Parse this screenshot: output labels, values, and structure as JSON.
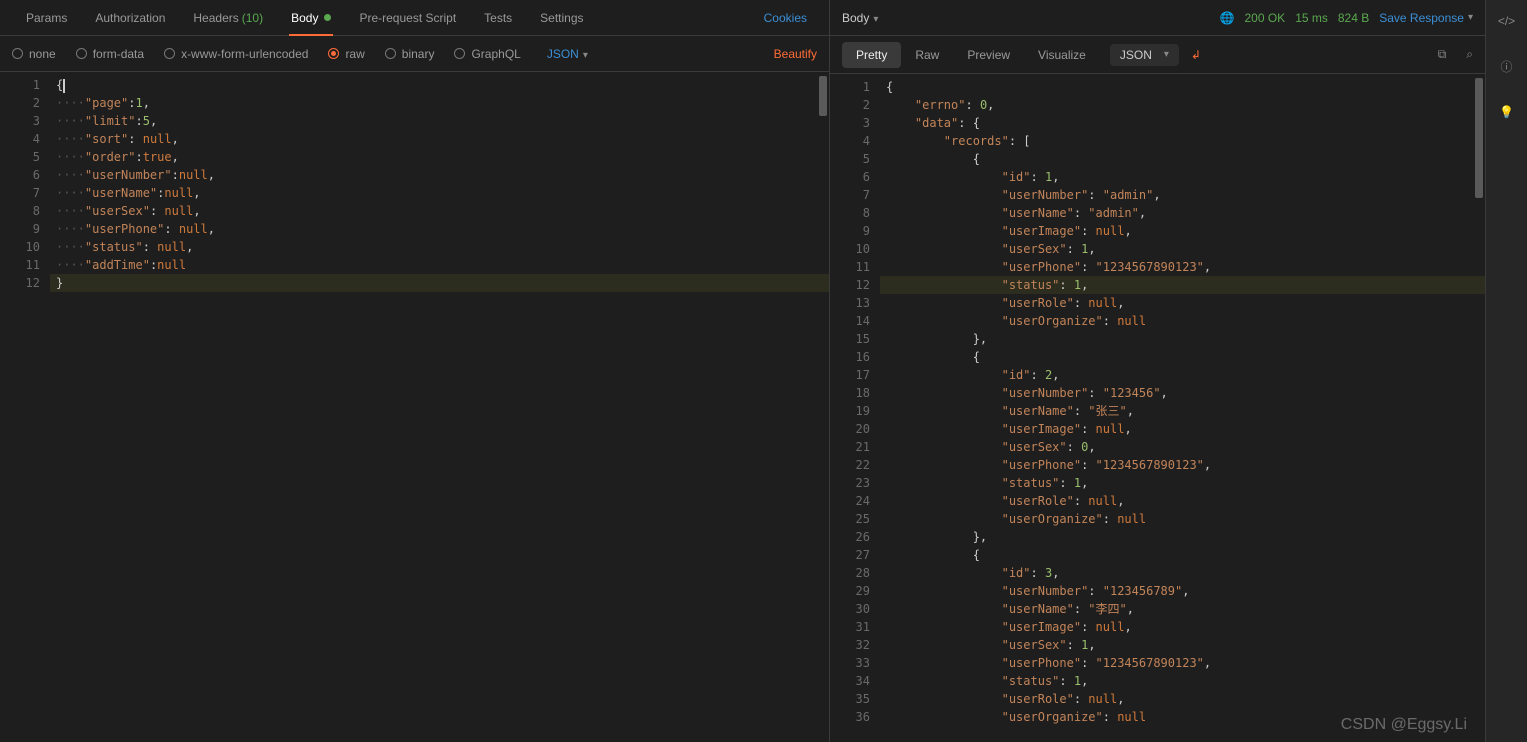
{
  "request": {
    "tabs": [
      {
        "label": "Params"
      },
      {
        "label": "Authorization"
      },
      {
        "label": "Headers",
        "count": "(10)"
      },
      {
        "label": "Body",
        "active": true,
        "dot": true
      },
      {
        "label": "Pre-request Script"
      },
      {
        "label": "Tests"
      },
      {
        "label": "Settings"
      }
    ],
    "cookies": "Cookies",
    "body_types": [
      {
        "label": "none"
      },
      {
        "label": "form-data"
      },
      {
        "label": "x-www-form-urlencoded"
      },
      {
        "label": "raw",
        "selected": true
      },
      {
        "label": "binary"
      },
      {
        "label": "GraphQL"
      }
    ],
    "content_type": "JSON",
    "beautify": "Beautify",
    "body_json": {
      "page": 1,
      "limit": 5,
      "sort": null,
      "order": true,
      "userNumber": null,
      "userName": null,
      "userSex": null,
      "userPhone": null,
      "status": null,
      "addTime": null
    }
  },
  "response": {
    "label": "Body",
    "status": "200 OK",
    "time": "15 ms",
    "size": "824 B",
    "save": "Save Response",
    "subtabs": [
      "Pretty",
      "Raw",
      "Preview",
      "Visualize"
    ],
    "active_subtab": "Pretty",
    "content_type": "JSON",
    "body": {
      "errno": 0,
      "data": {
        "records": [
          {
            "id": 1,
            "userNumber": "admin",
            "userName": "admin",
            "userImage": null,
            "userSex": 1,
            "userPhone": "1234567890123",
            "status": 1,
            "userRole": null,
            "userOrganize": null
          },
          {
            "id": 2,
            "userNumber": "123456",
            "userName": "张三",
            "userImage": null,
            "userSex": 0,
            "userPhone": "1234567890123",
            "status": 1,
            "userRole": null,
            "userOrganize": null
          },
          {
            "id": 3,
            "userNumber": "123456789",
            "userName": "李四",
            "userImage": null,
            "userSex": 1,
            "userPhone": "1234567890123",
            "status": 1,
            "userRole": null,
            "userOrganize": null
          }
        ]
      }
    }
  },
  "watermark": "CSDN @Eggsy.Li"
}
